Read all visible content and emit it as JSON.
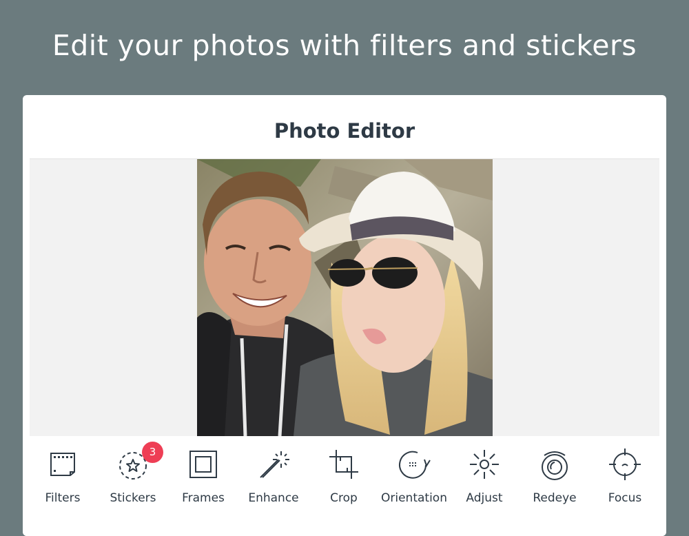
{
  "headline": "Edit your photos with filters and stickers",
  "editor": {
    "title": "Photo Editor"
  },
  "toolbar": {
    "tools": [
      {
        "label": "Filters",
        "icon": "filmstrip-icon"
      },
      {
        "label": "Stickers",
        "icon": "star-sticker-icon",
        "badge": "3"
      },
      {
        "label": "Frames",
        "icon": "frame-icon"
      },
      {
        "label": "Enhance",
        "icon": "magic-wand-icon"
      },
      {
        "label": "Crop",
        "icon": "crop-icon"
      },
      {
        "label": "Orientation",
        "icon": "rotate-icon"
      },
      {
        "label": "Adjust",
        "icon": "sun-icon"
      },
      {
        "label": "Redeye",
        "icon": "eye-icon"
      },
      {
        "label": "Focus",
        "icon": "crosshair-icon"
      }
    ]
  },
  "colors": {
    "background": "#6b7b7e",
    "badge": "#ee3e55",
    "text": "#2e3a45"
  }
}
